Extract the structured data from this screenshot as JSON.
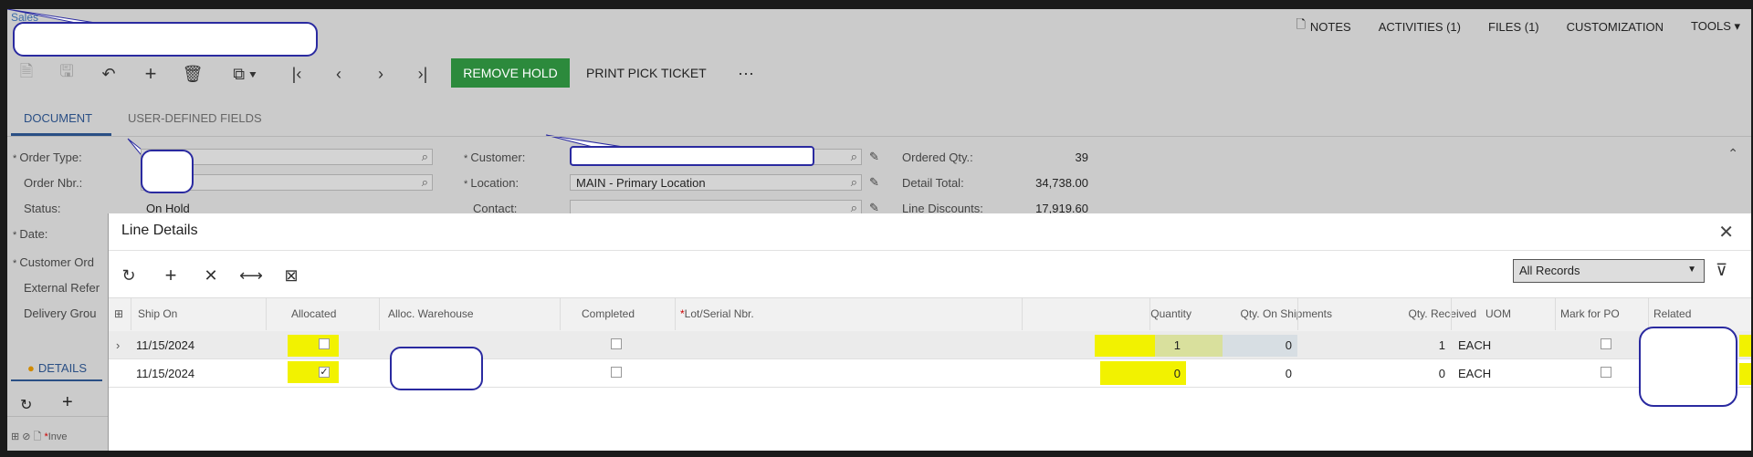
{
  "breadcrumb": "Sales",
  "top_actions": [
    {
      "label": "NOTES",
      "icon": "notes-icon"
    },
    {
      "label": "ACTIVITIES (1)"
    },
    {
      "label": "FILES (1)"
    },
    {
      "label": "CUSTOMIZATION"
    },
    {
      "label": "TOOLS ▾"
    }
  ],
  "toolbar": {
    "remove_hold": "REMOVE HOLD",
    "print_pick_ticket": "PRINT PICK TICKET",
    "more": "···"
  },
  "tabs": {
    "document": "DOCUMENT",
    "user_defined": "USER-DEFINED FIELDS"
  },
  "form": {
    "order_type_label": "Order Type:",
    "order_nbr_label": "Order Nbr.:",
    "status_label": "Status:",
    "status_value": "On Hold",
    "date_label": "Date:",
    "customer_order_label": "Customer Ord",
    "external_ref_label": "External Refer",
    "delivery_group_label": "Delivery Grou",
    "customer_label": "Customer:",
    "location_label": "Location:",
    "location_value": "MAIN - Primary Location",
    "contact_label": "Contact:",
    "ordered_qty_label": "Ordered Qty.:",
    "ordered_qty_value": "39",
    "detail_total_label": "Detail Total:",
    "detail_total_value": "34,738.00",
    "line_discounts_label": "Line Discounts:",
    "line_discounts_value": "17,919.60"
  },
  "details_tab": "DETAILS",
  "details_grid_header": "Inve",
  "modal": {
    "title": "Line Details",
    "filter_select": "All Records",
    "columns": {
      "ship_on": "Ship On",
      "allocated": "Allocated",
      "alloc_warehouse": "Alloc. Warehouse",
      "completed": "Completed",
      "lot_serial": "Lot/Serial Nbr.",
      "quantity": "Quantity",
      "qty_on_shipments": "Qty. On Shipments",
      "qty_received": "Qty. Received",
      "uom": "UOM",
      "mark_for_po": "Mark for PO",
      "related": "Related"
    },
    "rows": [
      {
        "ship_on": "11/15/2024",
        "allocated": false,
        "completed": false,
        "quantity": "1",
        "qty_on_shipments": "0",
        "qty_received": "1",
        "uom": "EACH",
        "mark_for_po": false
      },
      {
        "ship_on": "11/15/2024",
        "allocated": true,
        "completed": false,
        "quantity": "0",
        "qty_on_shipments": "0",
        "qty_received": "0",
        "uom": "EACH",
        "mark_for_po": false
      }
    ]
  },
  "colors": {
    "accent": "#2a4f85",
    "remove_hold_bg": "#2c8a3c",
    "highlight": "#f2f200",
    "callout_border": "#2a2aa0"
  }
}
